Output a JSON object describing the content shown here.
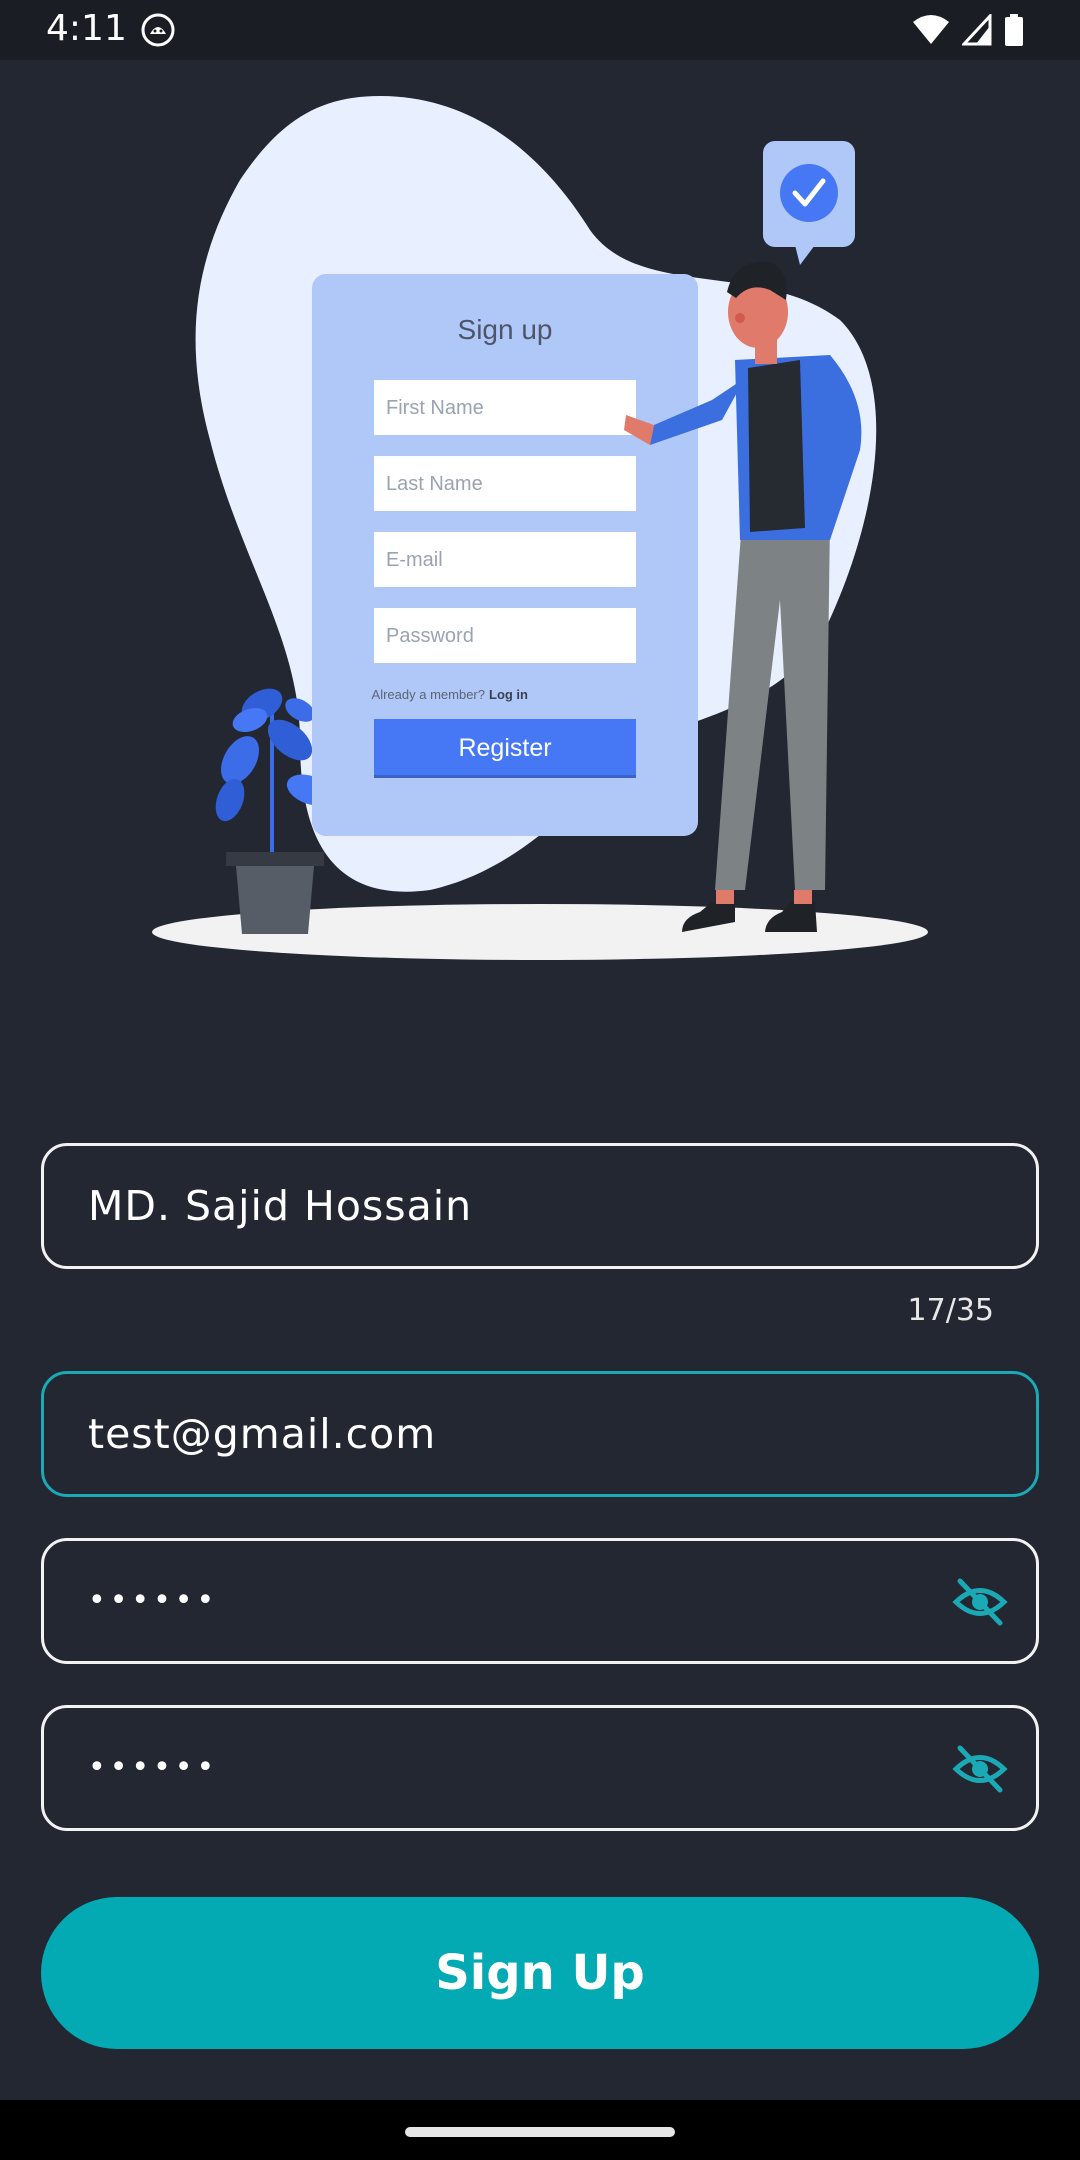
{
  "status_bar": {
    "time": "4:11",
    "icons": [
      "cat-app-icon",
      "wifi-icon",
      "signal-icon",
      "battery-icon"
    ]
  },
  "illustration": {
    "card_title": "Sign up",
    "first_name_placeholder": "First Name",
    "last_name_placeholder": "Last Name",
    "email_placeholder": "E-mail",
    "password_placeholder": "Password",
    "member_text": "Already a member?",
    "login_link": "Log in",
    "register_label": "Register"
  },
  "form": {
    "name_value": "MD. Sajid Hossain",
    "name_counter": "17/35",
    "email_value": "test@gmail.com",
    "password_value": "••••••",
    "confirm_password_value": "••••••",
    "toggle_icon": "eye-off-icon"
  },
  "signup_button": {
    "label": "Sign Up"
  },
  "colors": {
    "background": "#222732",
    "accent": "#03aab4",
    "focused_border": "#1ba9b5",
    "illustration_blue": "#4678f5"
  }
}
